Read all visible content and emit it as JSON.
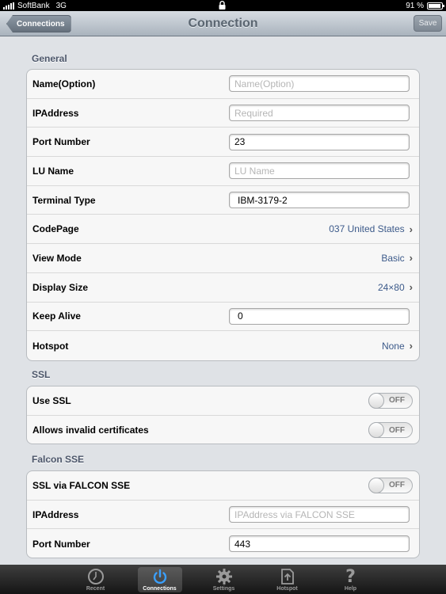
{
  "status_bar": {
    "carrier": "SoftBank",
    "network": "3G",
    "battery": "91 %",
    "battery_level": 0.91
  },
  "nav": {
    "title": "Connection",
    "back_label": "Connections",
    "save_label": "Save"
  },
  "general": {
    "header": "General",
    "name_label": "Name(Option)",
    "name_placeholder": "Name(Option)",
    "name_value": "",
    "ip_label": "IPAddress",
    "ip_placeholder": "Required",
    "ip_value": "",
    "port_label": "Port Number",
    "port_value": "23",
    "lu_label": "LU Name",
    "lu_placeholder": "LU Name",
    "lu_value": "",
    "terminal_label": "Terminal Type",
    "terminal_value": "IBM-3179-2",
    "codepage_label": "CodePage",
    "codepage_value": "037 United States",
    "viewmode_label": "View Mode",
    "viewmode_value": "Basic",
    "display_label": "Display Size",
    "display_value": "24×80",
    "keepalive_label": "Keep Alive",
    "keepalive_value": "0",
    "hotspot_label": "Hotspot",
    "hotspot_value": "None"
  },
  "ssl": {
    "header": "SSL",
    "use_ssl_label": "Use SSL",
    "use_ssl_state": "OFF",
    "invalid_cert_label": "Allows invalid certificates",
    "invalid_cert_state": "OFF"
  },
  "falcon": {
    "header": "Falcon SSE",
    "ssl_via_label": "SSL via FALCON SSE",
    "ssl_via_state": "OFF",
    "ip_label": "IPAddress",
    "ip_placeholder": "IPAddress via FALCON SSE",
    "ip_value": "",
    "port_label": "Port Number",
    "port_value": "443"
  },
  "tabs": [
    {
      "label": "Recent",
      "icon": "clock-icon"
    },
    {
      "label": "Connections",
      "icon": "power-icon",
      "active": true
    },
    {
      "label": "Settings",
      "icon": "gear-icon"
    },
    {
      "label": "Hotspot",
      "icon": "document-upload-icon"
    },
    {
      "label": "Help",
      "icon": "question-icon"
    }
  ]
}
